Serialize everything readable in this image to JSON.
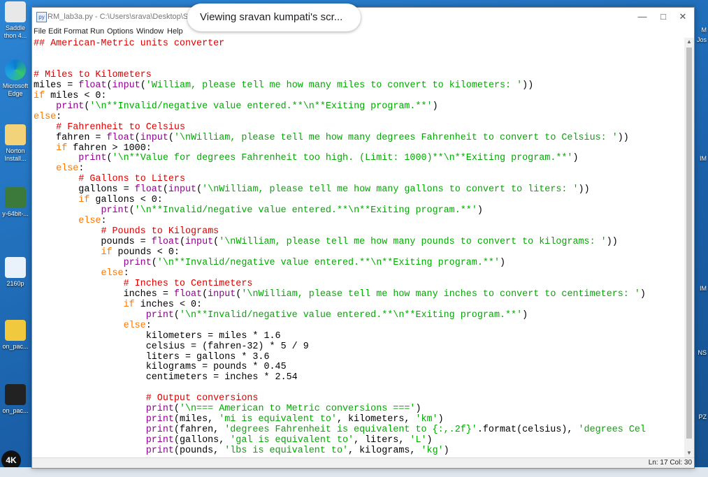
{
  "desktop": {
    "icons": [
      {
        "label": "Saddle\nthon 4..."
      },
      {
        "label": "Microsoft\nEdge"
      },
      {
        "label": "Norton\nInstall..."
      },
      {
        "label": "y-64bit-..."
      },
      {
        "label": "2160p"
      },
      {
        "label": "on_pac..."
      },
      {
        "label": "on_pac..."
      }
    ],
    "right_labels": [
      "M",
      "Jos",
      "IM",
      "IM",
      "NS",
      "PZ"
    ],
    "badge": "4K"
  },
  "screen_share": {
    "text": "Viewing sravan kumpati's scr..."
  },
  "window": {
    "title": "RM_lab3a.py - C:\\Users\\srava\\Desktop\\Srav",
    "menu": [
      "File",
      "Edit",
      "Format",
      "Run",
      "Options",
      "Window",
      "Help"
    ],
    "status": "Ln: 17 Col: 30"
  },
  "code_lines": [
    [
      {
        "t": "## American-Metric units converter",
        "c": "com"
      }
    ],
    [],
    [],
    [
      {
        "t": "# Miles to Kilometers",
        "c": "com"
      }
    ],
    [
      {
        "t": "miles = "
      },
      {
        "t": "float",
        "c": "bi"
      },
      {
        "t": "("
      },
      {
        "t": "input",
        "c": "bi"
      },
      {
        "t": "("
      },
      {
        "t": "'William, please tell me how many miles to convert to kilometers: '",
        "c": "str"
      },
      {
        "t": "))"
      }
    ],
    [
      {
        "t": "if",
        "c": "kw"
      },
      {
        "t": " miles < 0:"
      }
    ],
    [
      {
        "t": "    "
      },
      {
        "t": "print",
        "c": "bi"
      },
      {
        "t": "("
      },
      {
        "t": "'\\n**Invalid/negative value entered.**\\n**Exiting program.**'",
        "c": "str"
      },
      {
        "t": ")"
      }
    ],
    [
      {
        "t": "else",
        "c": "kw"
      },
      {
        "t": ":"
      }
    ],
    [
      {
        "t": "    "
      },
      {
        "t": "# Fahrenheit to Celsius",
        "c": "com"
      }
    ],
    [
      {
        "t": "    fahren = "
      },
      {
        "t": "float",
        "c": "bi"
      },
      {
        "t": "("
      },
      {
        "t": "input",
        "c": "bi"
      },
      {
        "t": "("
      },
      {
        "t": "'\\nWilliam, please tell me how many degrees Fahrenheit to convert to Celsius: '",
        "c": "str"
      },
      {
        "t": "))"
      }
    ],
    [
      {
        "t": "    "
      },
      {
        "t": "if",
        "c": "kw"
      },
      {
        "t": " fahren > 1000:"
      }
    ],
    [
      {
        "t": "        "
      },
      {
        "t": "print",
        "c": "bi"
      },
      {
        "t": "("
      },
      {
        "t": "'\\n**Value for degrees Fahrenheit too high. (Limit: 1000)**\\n**Exiting program.**'",
        "c": "str"
      },
      {
        "t": ")"
      }
    ],
    [
      {
        "t": "    "
      },
      {
        "t": "else",
        "c": "kw"
      },
      {
        "t": ":"
      }
    ],
    [
      {
        "t": "        "
      },
      {
        "t": "# Gallons to Liters",
        "c": "com"
      }
    ],
    [
      {
        "t": "        gallons = "
      },
      {
        "t": "float",
        "c": "bi"
      },
      {
        "t": "("
      },
      {
        "t": "input",
        "c": "bi"
      },
      {
        "t": "("
      },
      {
        "t": "'\\nWilliam, please tell me how many gallons to convert to liters: '",
        "c": "str"
      },
      {
        "t": "))"
      }
    ],
    [
      {
        "t": "        "
      },
      {
        "t": "if",
        "c": "kw"
      },
      {
        "t": " gallons < 0:"
      }
    ],
    [
      {
        "t": "            "
      },
      {
        "t": "print",
        "c": "bi"
      },
      {
        "t": "("
      },
      {
        "t": "'\\n**Invalid/negative value entered.**\\n**Exiting program.**'",
        "c": "str"
      },
      {
        "t": ")"
      }
    ],
    [
      {
        "t": "        "
      },
      {
        "t": "else",
        "c": "kw"
      },
      {
        "t": ":"
      }
    ],
    [
      {
        "t": "            "
      },
      {
        "t": "# Pounds to Kilograms",
        "c": "com"
      }
    ],
    [
      {
        "t": "            pounds = "
      },
      {
        "t": "float",
        "c": "bi"
      },
      {
        "t": "("
      },
      {
        "t": "input",
        "c": "bi"
      },
      {
        "t": "("
      },
      {
        "t": "'\\nWilliam, please tell me how many pounds to convert to kilograms: '",
        "c": "str"
      },
      {
        "t": "))"
      }
    ],
    [
      {
        "t": "            "
      },
      {
        "t": "if",
        "c": "kw"
      },
      {
        "t": " pounds < 0:"
      }
    ],
    [
      {
        "t": "                "
      },
      {
        "t": "print",
        "c": "bi"
      },
      {
        "t": "("
      },
      {
        "t": "'\\n**Invalid/negative value entered.**\\n**Exiting program.**'",
        "c": "str"
      },
      {
        "t": ")"
      }
    ],
    [
      {
        "t": "            "
      },
      {
        "t": "else",
        "c": "kw"
      },
      {
        "t": ":"
      }
    ],
    [
      {
        "t": "                "
      },
      {
        "t": "# Inches to Centimeters",
        "c": "com"
      }
    ],
    [
      {
        "t": "                inches = "
      },
      {
        "t": "float",
        "c": "bi"
      },
      {
        "t": "("
      },
      {
        "t": "input",
        "c": "bi"
      },
      {
        "t": "("
      },
      {
        "t": "'\\nWilliam, please tell me how many inches to convert to centimeters: '",
        "c": "str"
      },
      {
        "t": ")"
      }
    ],
    [
      {
        "t": "                "
      },
      {
        "t": "if",
        "c": "kw"
      },
      {
        "t": " inches < 0:"
      }
    ],
    [
      {
        "t": "                    "
      },
      {
        "t": "print",
        "c": "bi"
      },
      {
        "t": "("
      },
      {
        "t": "'\\n**Invalid/negative value entered.**\\n**Exiting program.**'",
        "c": "str"
      },
      {
        "t": ")"
      }
    ],
    [
      {
        "t": "                "
      },
      {
        "t": "else",
        "c": "kw"
      },
      {
        "t": ":"
      }
    ],
    [
      {
        "t": "                    kilometers = miles * 1.6"
      }
    ],
    [
      {
        "t": "                    celsius = (fahren-32) * 5 / 9"
      }
    ],
    [
      {
        "t": "                    liters = gallons * 3.6"
      }
    ],
    [
      {
        "t": "                    kilograms = pounds * 0.45"
      }
    ],
    [
      {
        "t": "                    centimeters = inches * 2.54"
      }
    ],
    [],
    [
      {
        "t": "                    "
      },
      {
        "t": "# Output conversions",
        "c": "com"
      }
    ],
    [
      {
        "t": "                    "
      },
      {
        "t": "print",
        "c": "bi"
      },
      {
        "t": "("
      },
      {
        "t": "'\\n=== American to Metric conversions ==='",
        "c": "str"
      },
      {
        "t": ")"
      }
    ],
    [
      {
        "t": "                    "
      },
      {
        "t": "print",
        "c": "bi"
      },
      {
        "t": "(miles, "
      },
      {
        "t": "'mi is equivalent to'",
        "c": "str"
      },
      {
        "t": ", kilometers, "
      },
      {
        "t": "'km'",
        "c": "str"
      },
      {
        "t": ")"
      }
    ],
    [
      {
        "t": "                    "
      },
      {
        "t": "print",
        "c": "bi"
      },
      {
        "t": "(fahren, "
      },
      {
        "t": "'degrees Fahrenheit is equivalent to {:,.2f}'",
        "c": "str"
      },
      {
        "t": ".format(celsius), "
      },
      {
        "t": "'degrees Cel",
        "c": "str"
      }
    ],
    [
      {
        "t": "                    "
      },
      {
        "t": "print",
        "c": "bi"
      },
      {
        "t": "(gallons, "
      },
      {
        "t": "'gal is equivalent to'",
        "c": "str"
      },
      {
        "t": ", liters, "
      },
      {
        "t": "'L'",
        "c": "str"
      },
      {
        "t": ")"
      }
    ],
    [
      {
        "t": "                    "
      },
      {
        "t": "print",
        "c": "bi"
      },
      {
        "t": "(pounds, "
      },
      {
        "t": "'lbs is equivalent to'",
        "c": "str"
      },
      {
        "t": ", kilograms, "
      },
      {
        "t": "'kg'",
        "c": "str"
      },
      {
        "t": ")"
      }
    ]
  ],
  "syntax_colors": {
    "com": "#dd0000",
    "kw": "#ff7700",
    "bi": "#900090",
    "str": "#00aa00",
    "default": "#000000"
  }
}
